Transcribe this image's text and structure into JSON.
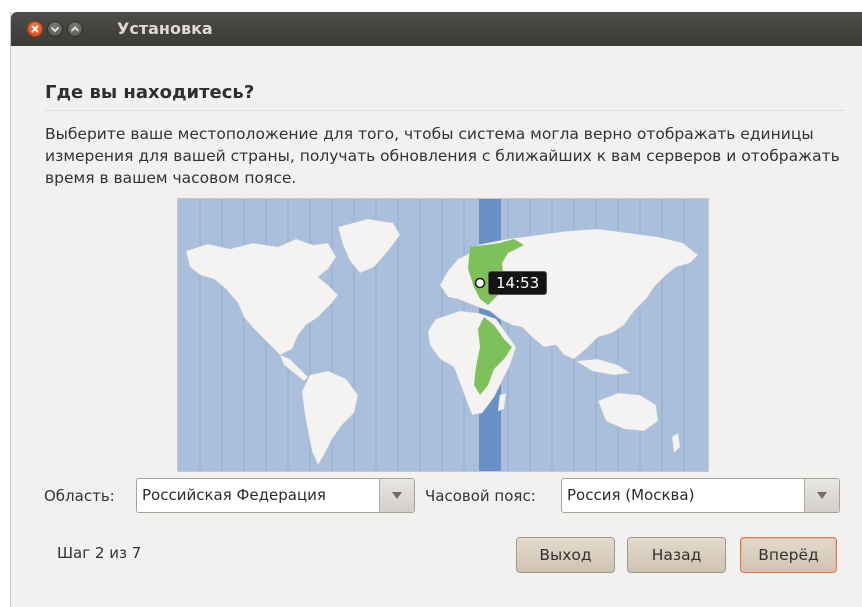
{
  "window": {
    "title": "Установка"
  },
  "page": {
    "heading": "Где вы находитесь?",
    "description": "Выберите ваше местоположение для того, чтобы система могла верно отображать единицы измерения для вашей страны, получать обновления с ближайших к вам серверов и отображать время в вашем часовом поясе."
  },
  "map": {
    "time": "14:53"
  },
  "region": {
    "label": "Область:",
    "value": "Российская Федерация"
  },
  "timezone": {
    "label": "Часовой пояс:",
    "value": "Россия (Москва)"
  },
  "footer": {
    "step": "Шаг 2 из 7",
    "quit_label": "Выход",
    "back_label": "Назад",
    "forward_label": "Вперёд"
  },
  "colors": {
    "ocean": "#a9bfdc",
    "land": "#f4f3f1",
    "highlight": "#7ec05a",
    "band": "#6a90c8"
  }
}
